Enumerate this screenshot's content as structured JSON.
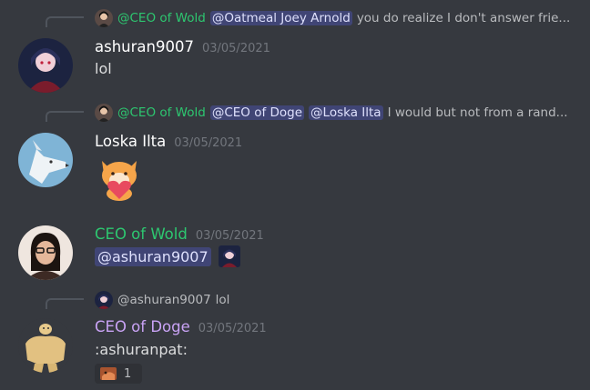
{
  "colors": {
    "background": "#36393f",
    "green_name": "#2dc770",
    "purple_name": "#c9a3f5",
    "white_name": "#ffffff",
    "mention_bg": "#414675",
    "timestamp": "#72767d"
  },
  "messages": [
    {
      "reply": {
        "author": "@CEO of Wold",
        "mentions": [
          "@Oatmeal Joey Arnold"
        ],
        "text": "you do realize I don't answer frie..."
      },
      "author": "ashuran9007",
      "timestamp": "03/05/2021",
      "content": "lol"
    },
    {
      "reply": {
        "author": "@CEO of Wold",
        "mentions": [
          "@CEO of Doge",
          "@Loska Ilta"
        ],
        "text": "I would but not from a rand..."
      },
      "author": "Loska Ilta",
      "timestamp": "03/05/2021",
      "content_sticker": "fox-heart-sticker"
    },
    {
      "author": "CEO of Wold",
      "timestamp": "03/05/2021",
      "mention": "@ashuran9007",
      "content_emoji": "ashuran-emoji"
    },
    {
      "reply": {
        "author": "@ashuran9007",
        "text": "lol"
      },
      "author": "CEO of Doge",
      "timestamp": "03/05/2021",
      "content": ":ashuranpat:",
      "reaction": {
        "emoji": "ashuranpat-emoji",
        "count": "1"
      }
    }
  ]
}
